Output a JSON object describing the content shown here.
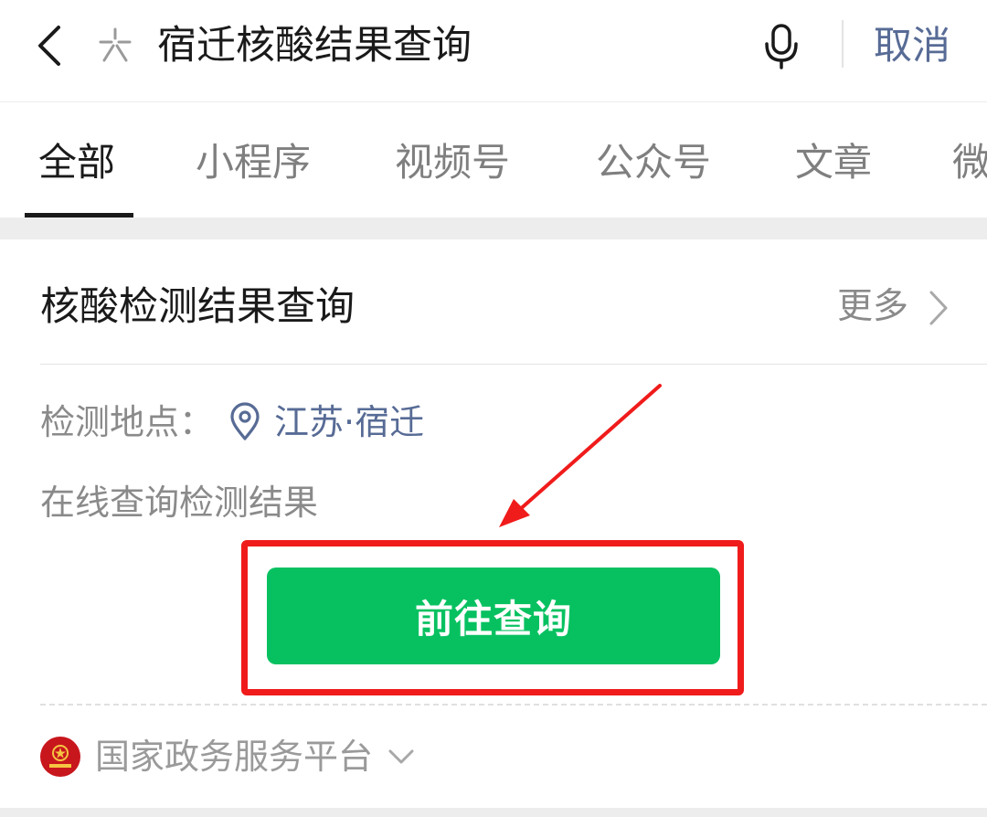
{
  "search": {
    "query": "宿迁核酸结果查询",
    "cancel_label": "取消"
  },
  "tabs": [
    {
      "label": "全部",
      "active": true
    },
    {
      "label": "小程序",
      "active": false
    },
    {
      "label": "视频号",
      "active": false
    },
    {
      "label": "公众号",
      "active": false
    },
    {
      "label": "文章",
      "active": false
    },
    {
      "label": "微",
      "active": false
    }
  ],
  "card": {
    "title": "核酸检测结果查询",
    "more_label": "更多",
    "location_label": "检测地点：",
    "location_value": "江苏·宿迁",
    "description": "在线查询检测结果",
    "action_label": "前往查询",
    "source_name": "国家政务服务平台",
    "source_logo_text": "国家政务服务平台"
  },
  "colors": {
    "accent_link": "#576b95",
    "button_green": "#07c160",
    "annotation_red": "#f01b1b"
  }
}
